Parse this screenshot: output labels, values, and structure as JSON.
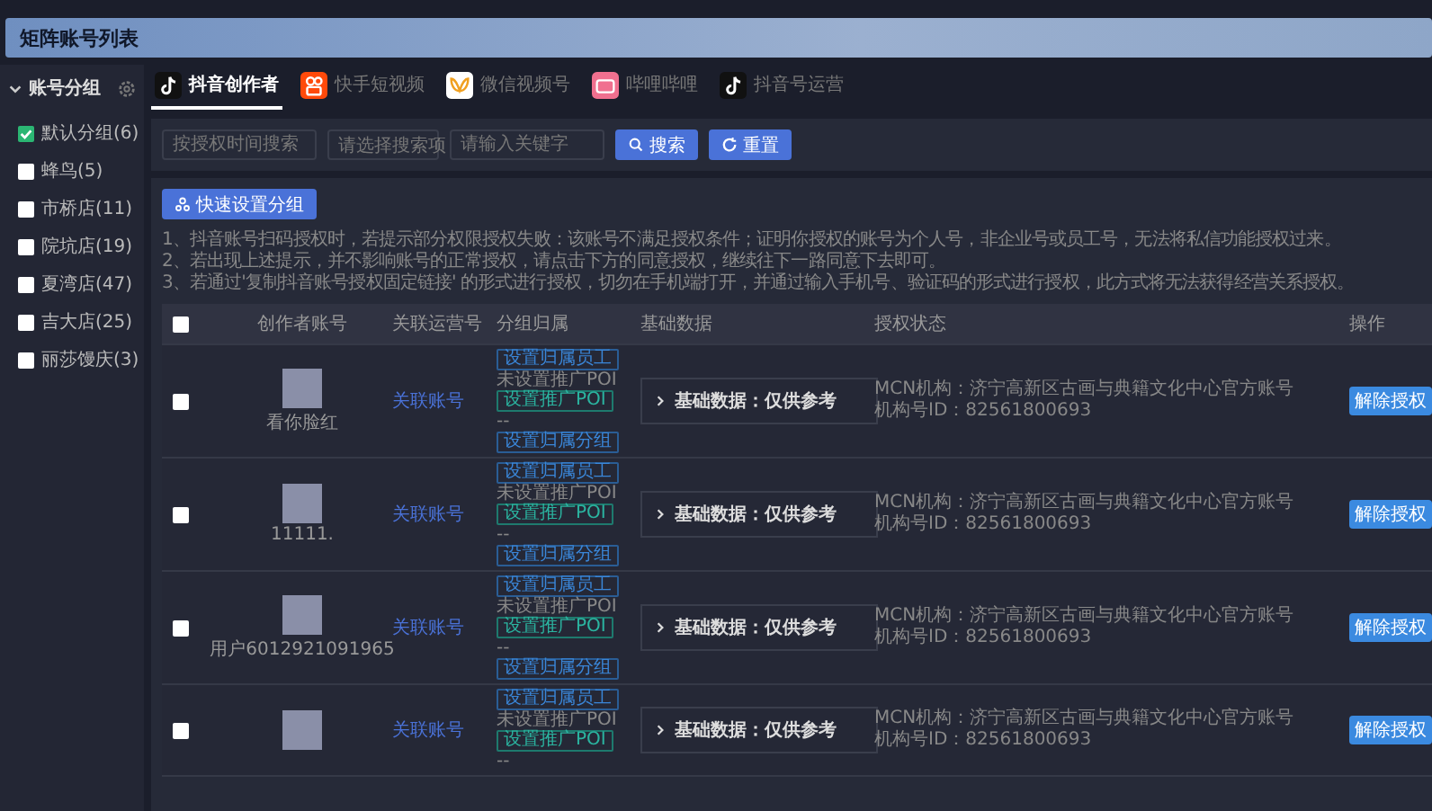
{
  "page_title": "矩阵账号列表",
  "sidebar": {
    "title": "账号分组",
    "items": [
      {
        "label": "默认分组(6)",
        "checked": true
      },
      {
        "label": "蜂鸟(5)",
        "checked": false
      },
      {
        "label": "市桥店(11)",
        "checked": false
      },
      {
        "label": "院坑店(19)",
        "checked": false
      },
      {
        "label": "夏湾店(47)",
        "checked": false
      },
      {
        "label": "吉大店(25)",
        "checked": false
      },
      {
        "label": "丽莎馒庆(3)",
        "checked": false
      }
    ]
  },
  "tabs": [
    {
      "label": "抖音创作者",
      "selected": true,
      "kind": "tiktok"
    },
    {
      "label": "快手短视频",
      "selected": false,
      "kind": "kuaishou"
    },
    {
      "label": "微信视频号",
      "selected": false,
      "kind": "wechat"
    },
    {
      "label": "哔哩哔哩",
      "selected": false,
      "kind": "bilibili"
    },
    {
      "label": "抖音号运营",
      "selected": false,
      "kind": "tiktok"
    }
  ],
  "filters": {
    "date_placeholder": "按授权时间搜索",
    "select_placeholder": "请选择搜索项",
    "keyword_placeholder": "请输入关键字",
    "search_button": "搜索",
    "reset_button": "重置"
  },
  "quick_group_button": "快速设置分组",
  "notes": [
    "1、抖音账号扫码授权时，若提示部分权限授权失败：该账号不满足授权条件；证明你授权的账号为个人号，非企业号或员工号，无法将私信功能授权过来。",
    "2、若出现上述提示，并不影响账号的正常授权，请点击下方的同意授权，继续往下一路同意下去即可。",
    "3、若通过'复制抖音账号授权固定链接' 的形式进行授权，切勿在手机端打开，并通过输入手机号、验证码的形式进行授权，此方式将无法获得经营关系授权。"
  ],
  "table": {
    "columns": [
      "创作者账号",
      "关联运营号",
      "分组归属",
      "基础数据",
      "授权状态",
      "操作"
    ],
    "all_checked": false,
    "rows": [
      {
        "checked": false,
        "name": "看你脸红",
        "link": "关联账号",
        "tag_employee": "设置归属员工",
        "poi_text": "未设置推广POI",
        "tag_poi": "设置推广POI",
        "dash": "--",
        "tag_group": "设置归属分组",
        "basic": "基础数据：仅供参考",
        "mcn": "MCN机构：济宁高新区古画与典籍文化中心官方账号",
        "org_id": "机构号ID：82561800693",
        "action": "解除授权"
      },
      {
        "checked": false,
        "name": "11111.",
        "link": "关联账号",
        "tag_employee": "设置归属员工",
        "poi_text": "未设置推广POI",
        "tag_poi": "设置推广POI",
        "dash": "--",
        "tag_group": "设置归属分组",
        "basic": "基础数据：仅供参考",
        "mcn": "MCN机构：济宁高新区古画与典籍文化中心官方账号",
        "org_id": "机构号ID：82561800693",
        "action": "解除授权"
      },
      {
        "checked": false,
        "name": "用户6012921091965",
        "link": "关联账号",
        "tag_employee": "设置归属员工",
        "poi_text": "未设置推广POI",
        "tag_poi": "设置推广POI",
        "dash": "--",
        "tag_group": "设置归属分组",
        "basic": "基础数据：仅供参考",
        "mcn": "MCN机构：济宁高新区古画与典籍文化中心官方账号",
        "org_id": "机构号ID：82561800693",
        "action": "解除授权"
      },
      {
        "checked": false,
        "link": "关联账号",
        "tag_employee": "设置归属员工",
        "poi_text": "未设置推广POI",
        "tag_poi": "设置推广POI",
        "dash": "--",
        "basic": "基础数据：仅供参考",
        "mcn": "MCN机构：济宁高新区古画与典籍文化中心官方账号",
        "org_id": "机构号ID：82561800693",
        "action": "解除授权"
      }
    ]
  }
}
